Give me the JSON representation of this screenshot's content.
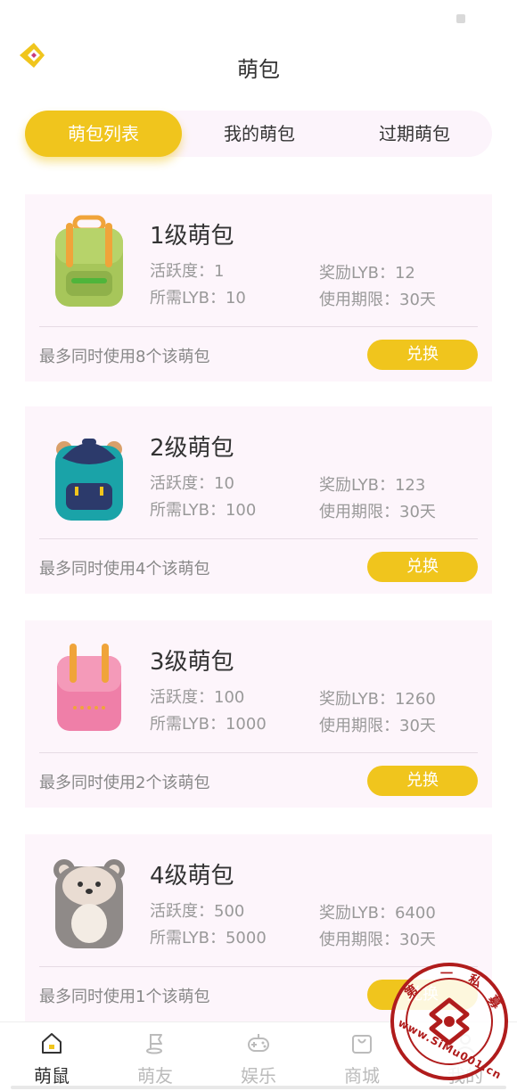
{
  "header": {
    "title": "萌包"
  },
  "tabs": [
    {
      "label": "萌包列表",
      "active": true
    },
    {
      "label": "我的萌包",
      "active": false
    },
    {
      "label": "过期萌包",
      "active": false
    }
  ],
  "packs": [
    {
      "title": "1级萌包",
      "activity": "活跃度：1",
      "required": "所需LYB：10",
      "reward": "奖励LYB：12",
      "period": "使用期限：30天",
      "note": "最多同时使用8个该萌包",
      "button": "兑换",
      "icon": "green-backpack-icon"
    },
    {
      "title": "2级萌包",
      "activity": "活跃度：10",
      "required": "所需LYB：100",
      "reward": "奖励LYB：123",
      "period": "使用期限：30天",
      "note": "最多同时使用4个该萌包",
      "button": "兑换",
      "icon": "teal-backpack-icon"
    },
    {
      "title": "3级萌包",
      "activity": "活跃度：100",
      "required": "所需LYB：1000",
      "reward": "奖励LYB：1260",
      "period": "使用期限：30天",
      "note": "最多同时使用2个该萌包",
      "button": "兑换",
      "icon": "pink-backpack-icon"
    },
    {
      "title": "4级萌包",
      "activity": "活跃度：500",
      "required": "所需LYB：5000",
      "reward": "奖励LYB：6400",
      "period": "使用期限：30天",
      "note": "最多同时使用1个该萌包",
      "button": "兑换",
      "icon": "raccoon-backpack-icon"
    }
  ],
  "bottom_nav": [
    {
      "label": "萌鼠",
      "active": true,
      "icon": "home-icon"
    },
    {
      "label": "萌友",
      "active": false,
      "icon": "flag-icon"
    },
    {
      "label": "娱乐",
      "active": false,
      "icon": "gamepad-icon"
    },
    {
      "label": "商城",
      "active": false,
      "icon": "shopping-bag-icon"
    },
    {
      "label": "我的",
      "active": false,
      "icon": "user-icon"
    }
  ],
  "watermark": {
    "left": "第",
    "mid": "一",
    "right": "私",
    "end": "募",
    "url": "www.SiMu001.cn"
  },
  "colors": {
    "accent": "#f0c51d",
    "card_bg": "#fdf5fb",
    "muted_text": "#999999"
  }
}
